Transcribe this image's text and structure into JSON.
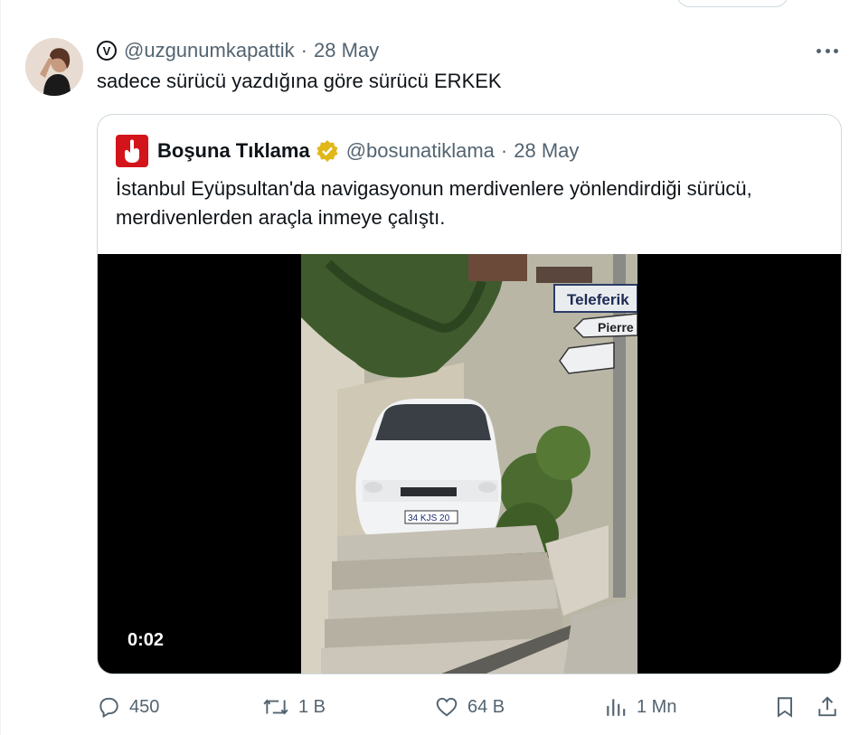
{
  "tweet": {
    "handle": "@uzgunumkapattik",
    "date": "28 May",
    "text": "sadece sürücü yazdığına göre sürücü ERKEK",
    "avatar_icon": "user-avatar",
    "badge_icon": "v-circle-icon"
  },
  "quote": {
    "name": "Boşuna Tıklama",
    "handle": "@bosunatiklama",
    "date": "28 May",
    "text": "İstanbul Eyüpsultan'da navigasyonun merdivenlere yönlendirdiği sürücü, merdivenlerden araçla inmeye çalıştı.",
    "verified_badge_color": "#e2b719",
    "brand_color": "#d4141b",
    "video": {
      "timer": "0:02",
      "signs": [
        "Teleferik",
        "Pierre"
      ],
      "plate": "34 KJS 20"
    }
  },
  "actions": {
    "replies": "450",
    "reposts": "1 B",
    "likes": "64 B",
    "views": "1 Mn"
  },
  "colors": {
    "text": "#0f1419",
    "secondary": "#536471",
    "border": "#cfd9de"
  }
}
